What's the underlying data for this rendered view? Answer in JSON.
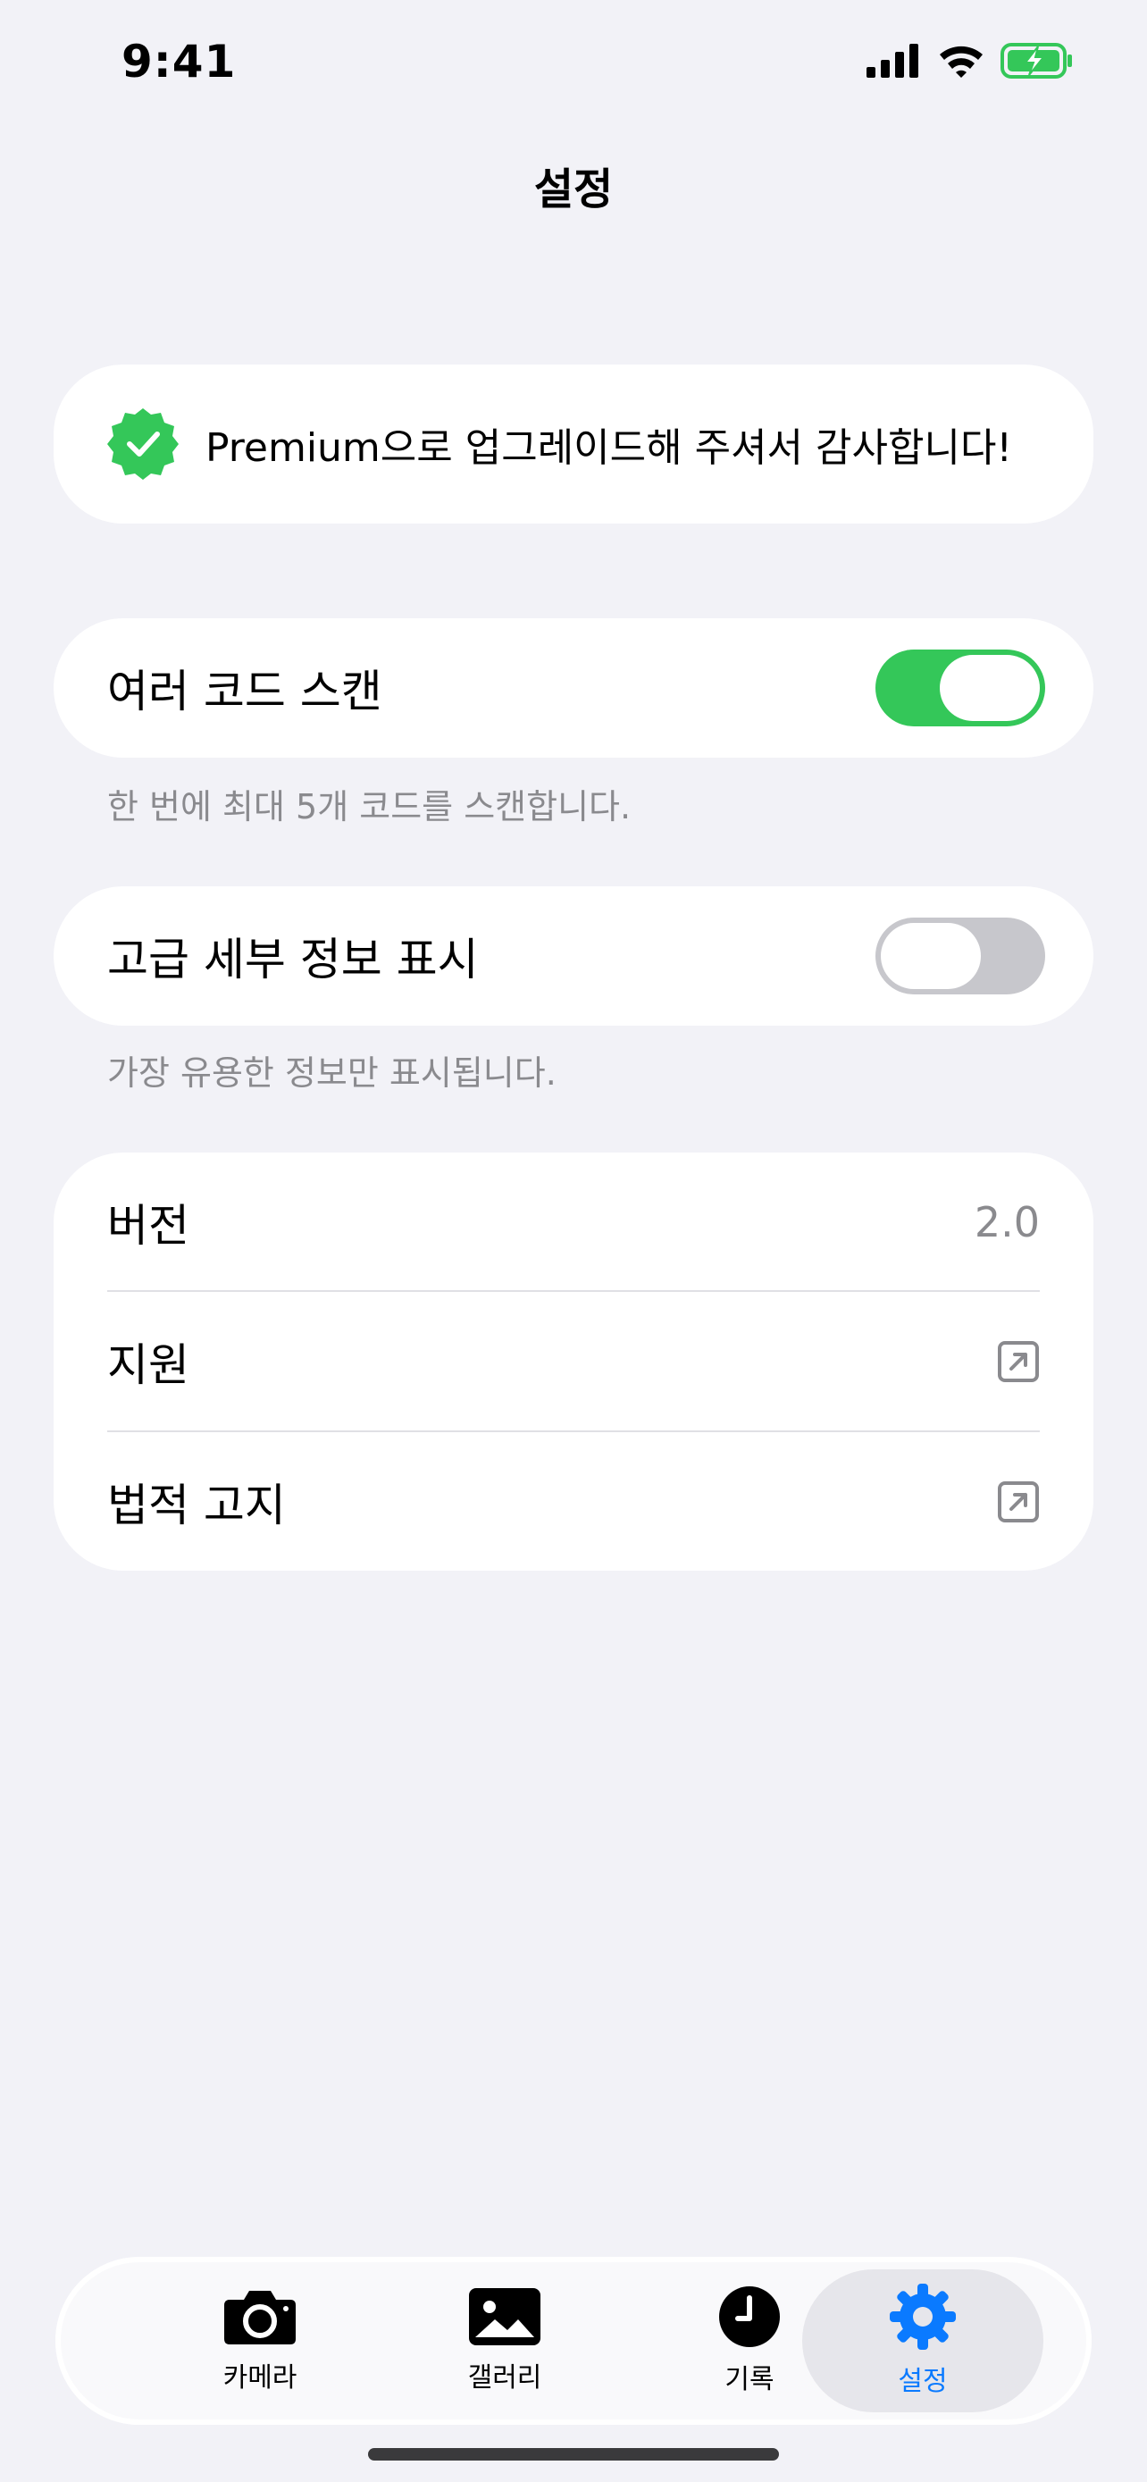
{
  "status_bar": {
    "time": "9:41"
  },
  "nav": {
    "title": "설정"
  },
  "premium": {
    "message": "Premium으로 업그레이드해 주셔서 감사합니다!"
  },
  "multi_scan": {
    "label": "여러 코드 스캔",
    "enabled": true,
    "footnote": "한 번에 최대 5개 코드를 스캔합니다."
  },
  "advanced_details": {
    "label": "고급 세부 정보 표시",
    "enabled": false,
    "footnote": "가장 유용한 정보만 표시됩니다."
  },
  "info_list": {
    "version_label": "버전",
    "version_value": "2.0",
    "support_label": "지원",
    "legal_label": "법적 고지"
  },
  "tab_bar": {
    "tabs": [
      {
        "label": "카메라",
        "icon": "camera-icon",
        "active": false
      },
      {
        "label": "갤러리",
        "icon": "photo-icon",
        "active": false
      },
      {
        "label": "기록",
        "icon": "clock-icon",
        "active": false
      },
      {
        "label": "설정",
        "icon": "gear-icon",
        "active": true
      }
    ]
  },
  "colors": {
    "background": "#F2F2F7",
    "accent": "#0A7AFF",
    "toggle_on": "#34C759",
    "badge_green": "#34C759",
    "secondary_text": "#8A8A8E"
  }
}
